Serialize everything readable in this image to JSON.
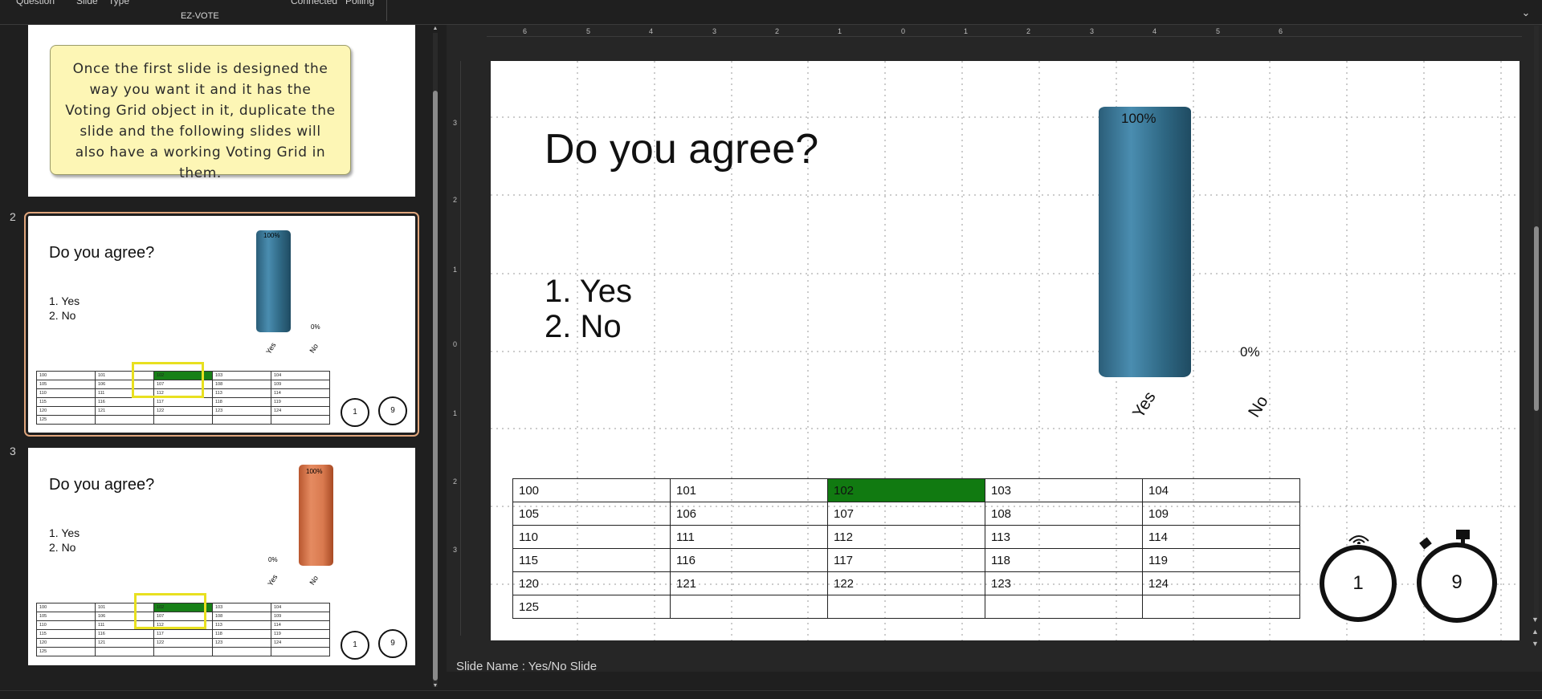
{
  "ribbon": {
    "cut_labels": [
      "Question",
      "Slide",
      "Type",
      "Connected",
      "Polling"
    ],
    "group_label": "EZ-VOTE"
  },
  "thumbnails": {
    "slide1_note": "Once the first slide is designed the way you want it and it has the Voting Grid object in it, duplicate the slide and the following slides will also have a working Voting Grid in them.",
    "slides": [
      {
        "number": "2",
        "title": "Do you agree?",
        "options": [
          "1.  Yes",
          "2.  No"
        ],
        "bar_value": "100%",
        "other_value": "0%",
        "cat_yes": "Yes",
        "cat_no": "No",
        "timer_a": "1",
        "timer_b": "9"
      },
      {
        "number": "3",
        "title": "Do you agree?",
        "options": [
          "1.  Yes",
          "2.  No"
        ],
        "bar_value": "100%",
        "other_value": "0%",
        "cat_yes": "Yes",
        "cat_no": "No",
        "timer_a": "1",
        "timer_b": "9"
      }
    ]
  },
  "grid": {
    "rows": [
      [
        "100",
        "101",
        "102",
        "103",
        "104"
      ],
      [
        "105",
        "106",
        "107",
        "108",
        "109"
      ],
      [
        "110",
        "111",
        "112",
        "113",
        "114"
      ],
      [
        "115",
        "116",
        "117",
        "118",
        "119"
      ],
      [
        "120",
        "121",
        "122",
        "123",
        "124"
      ],
      [
        "125",
        "",
        "",
        "",
        ""
      ]
    ],
    "highlight_color": "#117a11"
  },
  "ruler": {
    "h": [
      "6",
      "5",
      "4",
      "3",
      "2",
      "1",
      "0",
      "1",
      "2",
      "3",
      "4",
      "5",
      "6"
    ],
    "v": [
      "3",
      "2",
      "1",
      "0",
      "1",
      "2",
      "3"
    ]
  },
  "main_slide": {
    "title": "Do you agree?",
    "option1": "1.  Yes",
    "option2": "2.  No",
    "bar_label": "100%",
    "no_label": "0%",
    "cat_yes": "Yes",
    "cat_no": "No",
    "timer_left": "1",
    "timer_right": "9"
  },
  "chart_data": {
    "type": "bar",
    "categories": [
      "Yes",
      "No"
    ],
    "values": [
      100,
      0
    ],
    "ylim": [
      0,
      100
    ]
  },
  "status": {
    "slide_name": "Slide Name : Yes/No Slide"
  },
  "colors": {
    "bar_blue": "#2f6884",
    "bar_orange": "#d97a4f",
    "selection_outline": "#e0a67d",
    "highlight_box": "#e8e020"
  }
}
